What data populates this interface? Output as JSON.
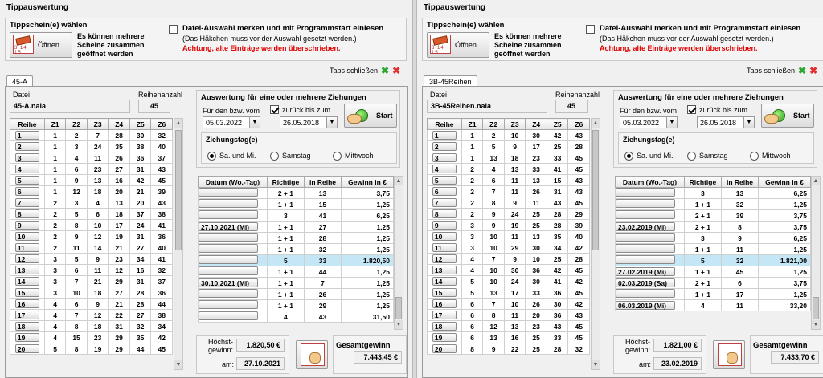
{
  "title": "Tippauswertung",
  "select_label": "Tippschein(e) wählen",
  "open_button": "Öffnen...",
  "open_hint": [
    "Es können mehrere",
    "Scheine zusammen",
    "geöffnet werden"
  ],
  "remember_label": "Datei-Auswahl merken und mit Programmstart einlesen",
  "remember_note": "(Das Häkchen muss vor der Auswahl gesetzt werden.)",
  "remember_warning": "Achtung, alte Einträge werden überschrieben.",
  "close_tabs": "Tabs schließen",
  "datei_label": "Datei",
  "reihenanzahl_label": "Reihenanzahl",
  "eval_title": "Auswertung für eine oder mehrere Ziehungen",
  "from_label": "Für den bzw. vom",
  "back_label": "zurück bis zum",
  "start_label": "Start",
  "ziehungstag_title": "Ziehungstag(e)",
  "radio_options": [
    "Sa. und Mi.",
    "Samstag",
    "Mittwoch"
  ],
  "grid_headers": [
    "Reihe",
    "Z1",
    "Z2",
    "Z3",
    "Z4",
    "Z5",
    "Z6"
  ],
  "res_headers": [
    "Datum (Wo.-Tag)",
    "Richtige",
    "in Reihe",
    "Gewinn in €"
  ],
  "hoechst_label": [
    "Höchst-",
    "gewinn:"
  ],
  "am_label": "am:",
  "gesamt_label": "Gesamtgewinn",
  "colors": {
    "highlight": "#c5e6f5",
    "warning": "#e00000"
  },
  "panels": [
    {
      "tab": "45-A",
      "file": "45-A.nala",
      "count": "45",
      "from_date": "05.03.2022",
      "to_date": "26.05.2018",
      "back_checked": true,
      "rows": [
        [
          "1",
          "1",
          "2",
          "7",
          "28",
          "30",
          "32"
        ],
        [
          "2",
          "1",
          "3",
          "24",
          "35",
          "38",
          "40"
        ],
        [
          "3",
          "1",
          "4",
          "11",
          "26",
          "36",
          "37"
        ],
        [
          "4",
          "1",
          "6",
          "23",
          "27",
          "31",
          "43"
        ],
        [
          "5",
          "1",
          "9",
          "13",
          "16",
          "42",
          "45"
        ],
        [
          "6",
          "1",
          "12",
          "18",
          "20",
          "21",
          "39"
        ],
        [
          "7",
          "2",
          "3",
          "4",
          "13",
          "20",
          "43"
        ],
        [
          "8",
          "2",
          "5",
          "6",
          "18",
          "37",
          "38"
        ],
        [
          "9",
          "2",
          "8",
          "10",
          "17",
          "24",
          "41"
        ],
        [
          "10",
          "2",
          "9",
          "12",
          "19",
          "31",
          "36"
        ],
        [
          "11",
          "2",
          "11",
          "14",
          "21",
          "27",
          "40"
        ],
        [
          "12",
          "3",
          "5",
          "9",
          "23",
          "34",
          "41"
        ],
        [
          "13",
          "3",
          "6",
          "11",
          "12",
          "16",
          "32"
        ],
        [
          "14",
          "3",
          "7",
          "21",
          "29",
          "31",
          "37"
        ],
        [
          "15",
          "3",
          "10",
          "18",
          "27",
          "28",
          "36"
        ],
        [
          "16",
          "4",
          "6",
          "9",
          "21",
          "28",
          "44"
        ],
        [
          "17",
          "4",
          "7",
          "12",
          "22",
          "27",
          "38"
        ],
        [
          "18",
          "4",
          "8",
          "18",
          "31",
          "32",
          "34"
        ],
        [
          "19",
          "4",
          "15",
          "23",
          "29",
          "35",
          "42"
        ],
        [
          "20",
          "5",
          "8",
          "19",
          "29",
          "44",
          "45"
        ]
      ],
      "results": [
        [
          "",
          "2 + 1",
          "13",
          "3,75"
        ],
        [
          "",
          "1 + 1",
          "15",
          "1,25"
        ],
        [
          "",
          "3",
          "41",
          "6,25"
        ],
        [
          "27.10.2021 (Mi)",
          "1 + 1",
          "27",
          "1,25"
        ],
        [
          "",
          "1 + 1",
          "28",
          "1,25"
        ],
        [
          "",
          "1 + 1",
          "32",
          "1,25"
        ],
        [
          "",
          "5",
          "33",
          "1.820,50"
        ],
        [
          "",
          "1 + 1",
          "44",
          "1,25"
        ],
        [
          "30.10.2021 (Mi)",
          "1 + 1",
          "7",
          "1,25"
        ],
        [
          "",
          "1 + 1",
          "26",
          "1,25"
        ],
        [
          "",
          "1 + 1",
          "29",
          "1,25"
        ],
        [
          "",
          "4",
          "43",
          "31,50"
        ]
      ],
      "hl_row": 6,
      "hoechst": "1.820,50 €",
      "am": "27.10.2021",
      "gesamt": "7.443,45 €"
    },
    {
      "tab": "3B-45Reihen",
      "file": "3B-45Reihen.nala",
      "count": "45",
      "from_date": "05.03.2022",
      "to_date": "26.05.2018",
      "back_checked": true,
      "rows": [
        [
          "1",
          "1",
          "2",
          "10",
          "30",
          "42",
          "43"
        ],
        [
          "2",
          "1",
          "5",
          "9",
          "17",
          "25",
          "28"
        ],
        [
          "3",
          "1",
          "13",
          "18",
          "23",
          "33",
          "45"
        ],
        [
          "4",
          "2",
          "4",
          "13",
          "33",
          "41",
          "45"
        ],
        [
          "5",
          "2",
          "6",
          "11",
          "13",
          "15",
          "43"
        ],
        [
          "6",
          "2",
          "7",
          "11",
          "26",
          "31",
          "43"
        ],
        [
          "7",
          "2",
          "8",
          "9",
          "11",
          "43",
          "45"
        ],
        [
          "8",
          "2",
          "9",
          "24",
          "25",
          "28",
          "29"
        ],
        [
          "9",
          "3",
          "9",
          "19",
          "25",
          "28",
          "39"
        ],
        [
          "10",
          "3",
          "10",
          "11",
          "13",
          "35",
          "40"
        ],
        [
          "11",
          "3",
          "10",
          "29",
          "30",
          "34",
          "42"
        ],
        [
          "12",
          "4",
          "7",
          "9",
          "10",
          "25",
          "28"
        ],
        [
          "13",
          "4",
          "10",
          "30",
          "36",
          "42",
          "45"
        ],
        [
          "14",
          "5",
          "10",
          "24",
          "30",
          "41",
          "42"
        ],
        [
          "15",
          "5",
          "13",
          "17",
          "33",
          "36",
          "45"
        ],
        [
          "16",
          "6",
          "7",
          "10",
          "26",
          "30",
          "42"
        ],
        [
          "17",
          "6",
          "8",
          "11",
          "20",
          "36",
          "43"
        ],
        [
          "18",
          "6",
          "12",
          "13",
          "23",
          "43",
          "45"
        ],
        [
          "19",
          "6",
          "13",
          "16",
          "25",
          "33",
          "45"
        ],
        [
          "20",
          "8",
          "9",
          "22",
          "25",
          "28",
          "32"
        ]
      ],
      "results": [
        [
          "",
          "3",
          "13",
          "6,25"
        ],
        [
          "",
          "1 + 1",
          "32",
          "1,25"
        ],
        [
          "",
          "2 + 1",
          "39",
          "3,75"
        ],
        [
          "23.02.2019 (Mi)",
          "2 + 1",
          "8",
          "3,75"
        ],
        [
          "",
          "3",
          "9",
          "6,25"
        ],
        [
          "",
          "1 + 1",
          "11",
          "1,25"
        ],
        [
          "",
          "5",
          "32",
          "1.821,00"
        ],
        [
          "27.02.2019 (Mi)",
          "1 + 1",
          "45",
          "1,25"
        ],
        [
          "02.03.2019 (Sa)",
          "2 + 1",
          "6",
          "3,75"
        ],
        [
          "",
          "1 + 1",
          "17",
          "1,25"
        ],
        [
          "06.03.2019 (Mi)",
          "4",
          "11",
          "33,20"
        ]
      ],
      "hl_row": 6,
      "hoechst": "1.821,00 €",
      "am": "23.02.2019",
      "gesamt": "7.433,70 €"
    }
  ]
}
